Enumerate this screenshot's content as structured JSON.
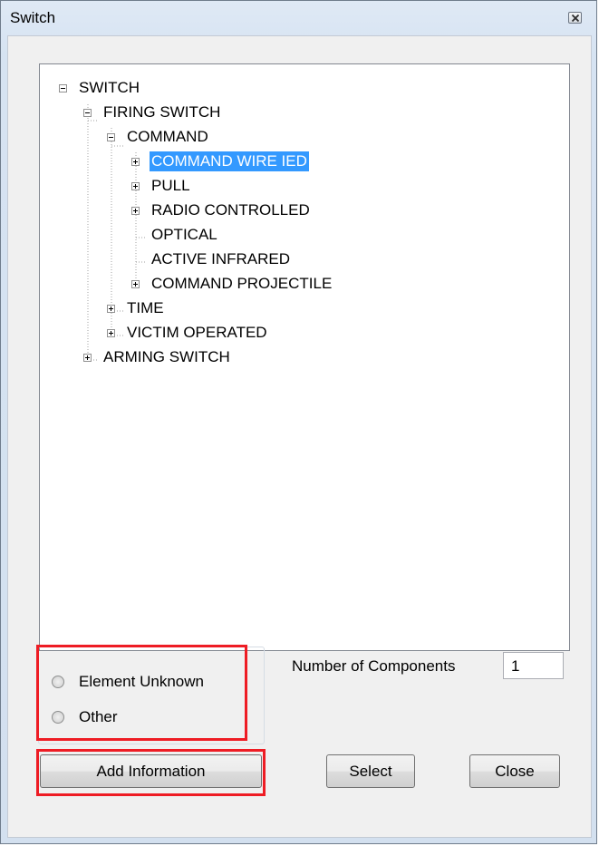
{
  "window": {
    "title": "Switch"
  },
  "tree": {
    "nodes": [
      {
        "label": "SWITCH",
        "expander": "minus"
      },
      {
        "label": "FIRING SWITCH",
        "expander": "minus"
      },
      {
        "label": "COMMAND",
        "expander": "minus"
      },
      {
        "label": "COMMAND WIRE IED",
        "expander": "plus",
        "selected": true
      },
      {
        "label": "PULL",
        "expander": "plus"
      },
      {
        "label": "RADIO CONTROLLED",
        "expander": "plus"
      },
      {
        "label": "OPTICAL",
        "expander": "none"
      },
      {
        "label": "ACTIVE INFRARED",
        "expander": "none"
      },
      {
        "label": "COMMAND PROJECTILE",
        "expander": "plus"
      },
      {
        "label": "TIME",
        "expander": "plus"
      },
      {
        "label": "VICTIM OPERATED",
        "expander": "plus"
      },
      {
        "label": "ARMING SWITCH",
        "expander": "plus"
      }
    ]
  },
  "options": {
    "element_unknown_label": "Element Unknown",
    "other_label": "Other"
  },
  "components": {
    "label": "Number of Components",
    "value": "1"
  },
  "buttons": {
    "add_information": "Add Information",
    "select": "Select",
    "close": "Close"
  },
  "colors": {
    "selection": "#3399ff",
    "highlight_box": "#ee1c24"
  }
}
